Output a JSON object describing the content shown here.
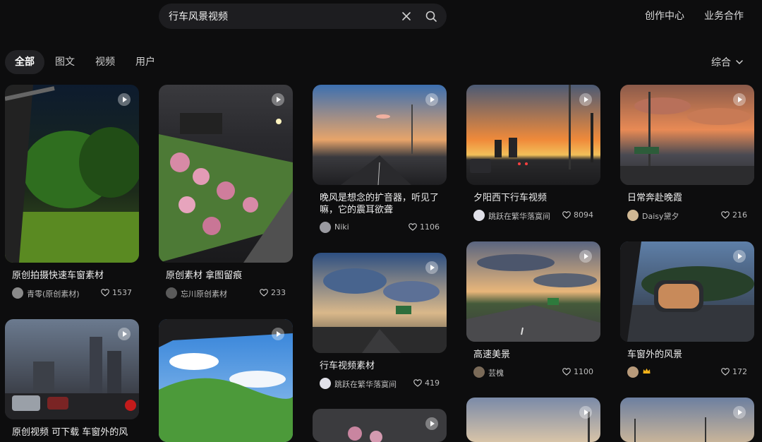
{
  "search": {
    "value": "行车风景视频"
  },
  "header": {
    "links": [
      "创作中心",
      "业务合作"
    ]
  },
  "tabs": [
    "全部",
    "图文",
    "视频",
    "用户"
  ],
  "sort": {
    "label": "综合"
  },
  "cards": [
    {
      "title": "原创拍摄快速车窗素材",
      "author": "青零(原创素材)",
      "likes": "1537"
    },
    {
      "title": "原创素材 拿图留痕",
      "author": "忘川原创素材",
      "likes": "233"
    },
    {
      "title": "晚风是想念的扩音器，听见了嘛，它的震耳欲聋",
      "author": "Niki",
      "likes": "1106"
    },
    {
      "title": "夕阳西下行车视频",
      "author": "跳跃在繁华落寞间",
      "likes": "8094"
    },
    {
      "title": "日常奔赴晚霞",
      "author": "Daisy黛夕",
      "likes": "216"
    },
    {
      "title": "行车视频素材",
      "author": "跳跃在繁华落寞间",
      "likes": "419"
    },
    {
      "title": "高速美景",
      "author": "芸槐",
      "likes": "1100"
    },
    {
      "title": "车窗外的风景",
      "author": "",
      "likes": "172"
    },
    {
      "title": "原创视频 可下载 车窗外的风",
      "author": "",
      "likes": ""
    }
  ]
}
